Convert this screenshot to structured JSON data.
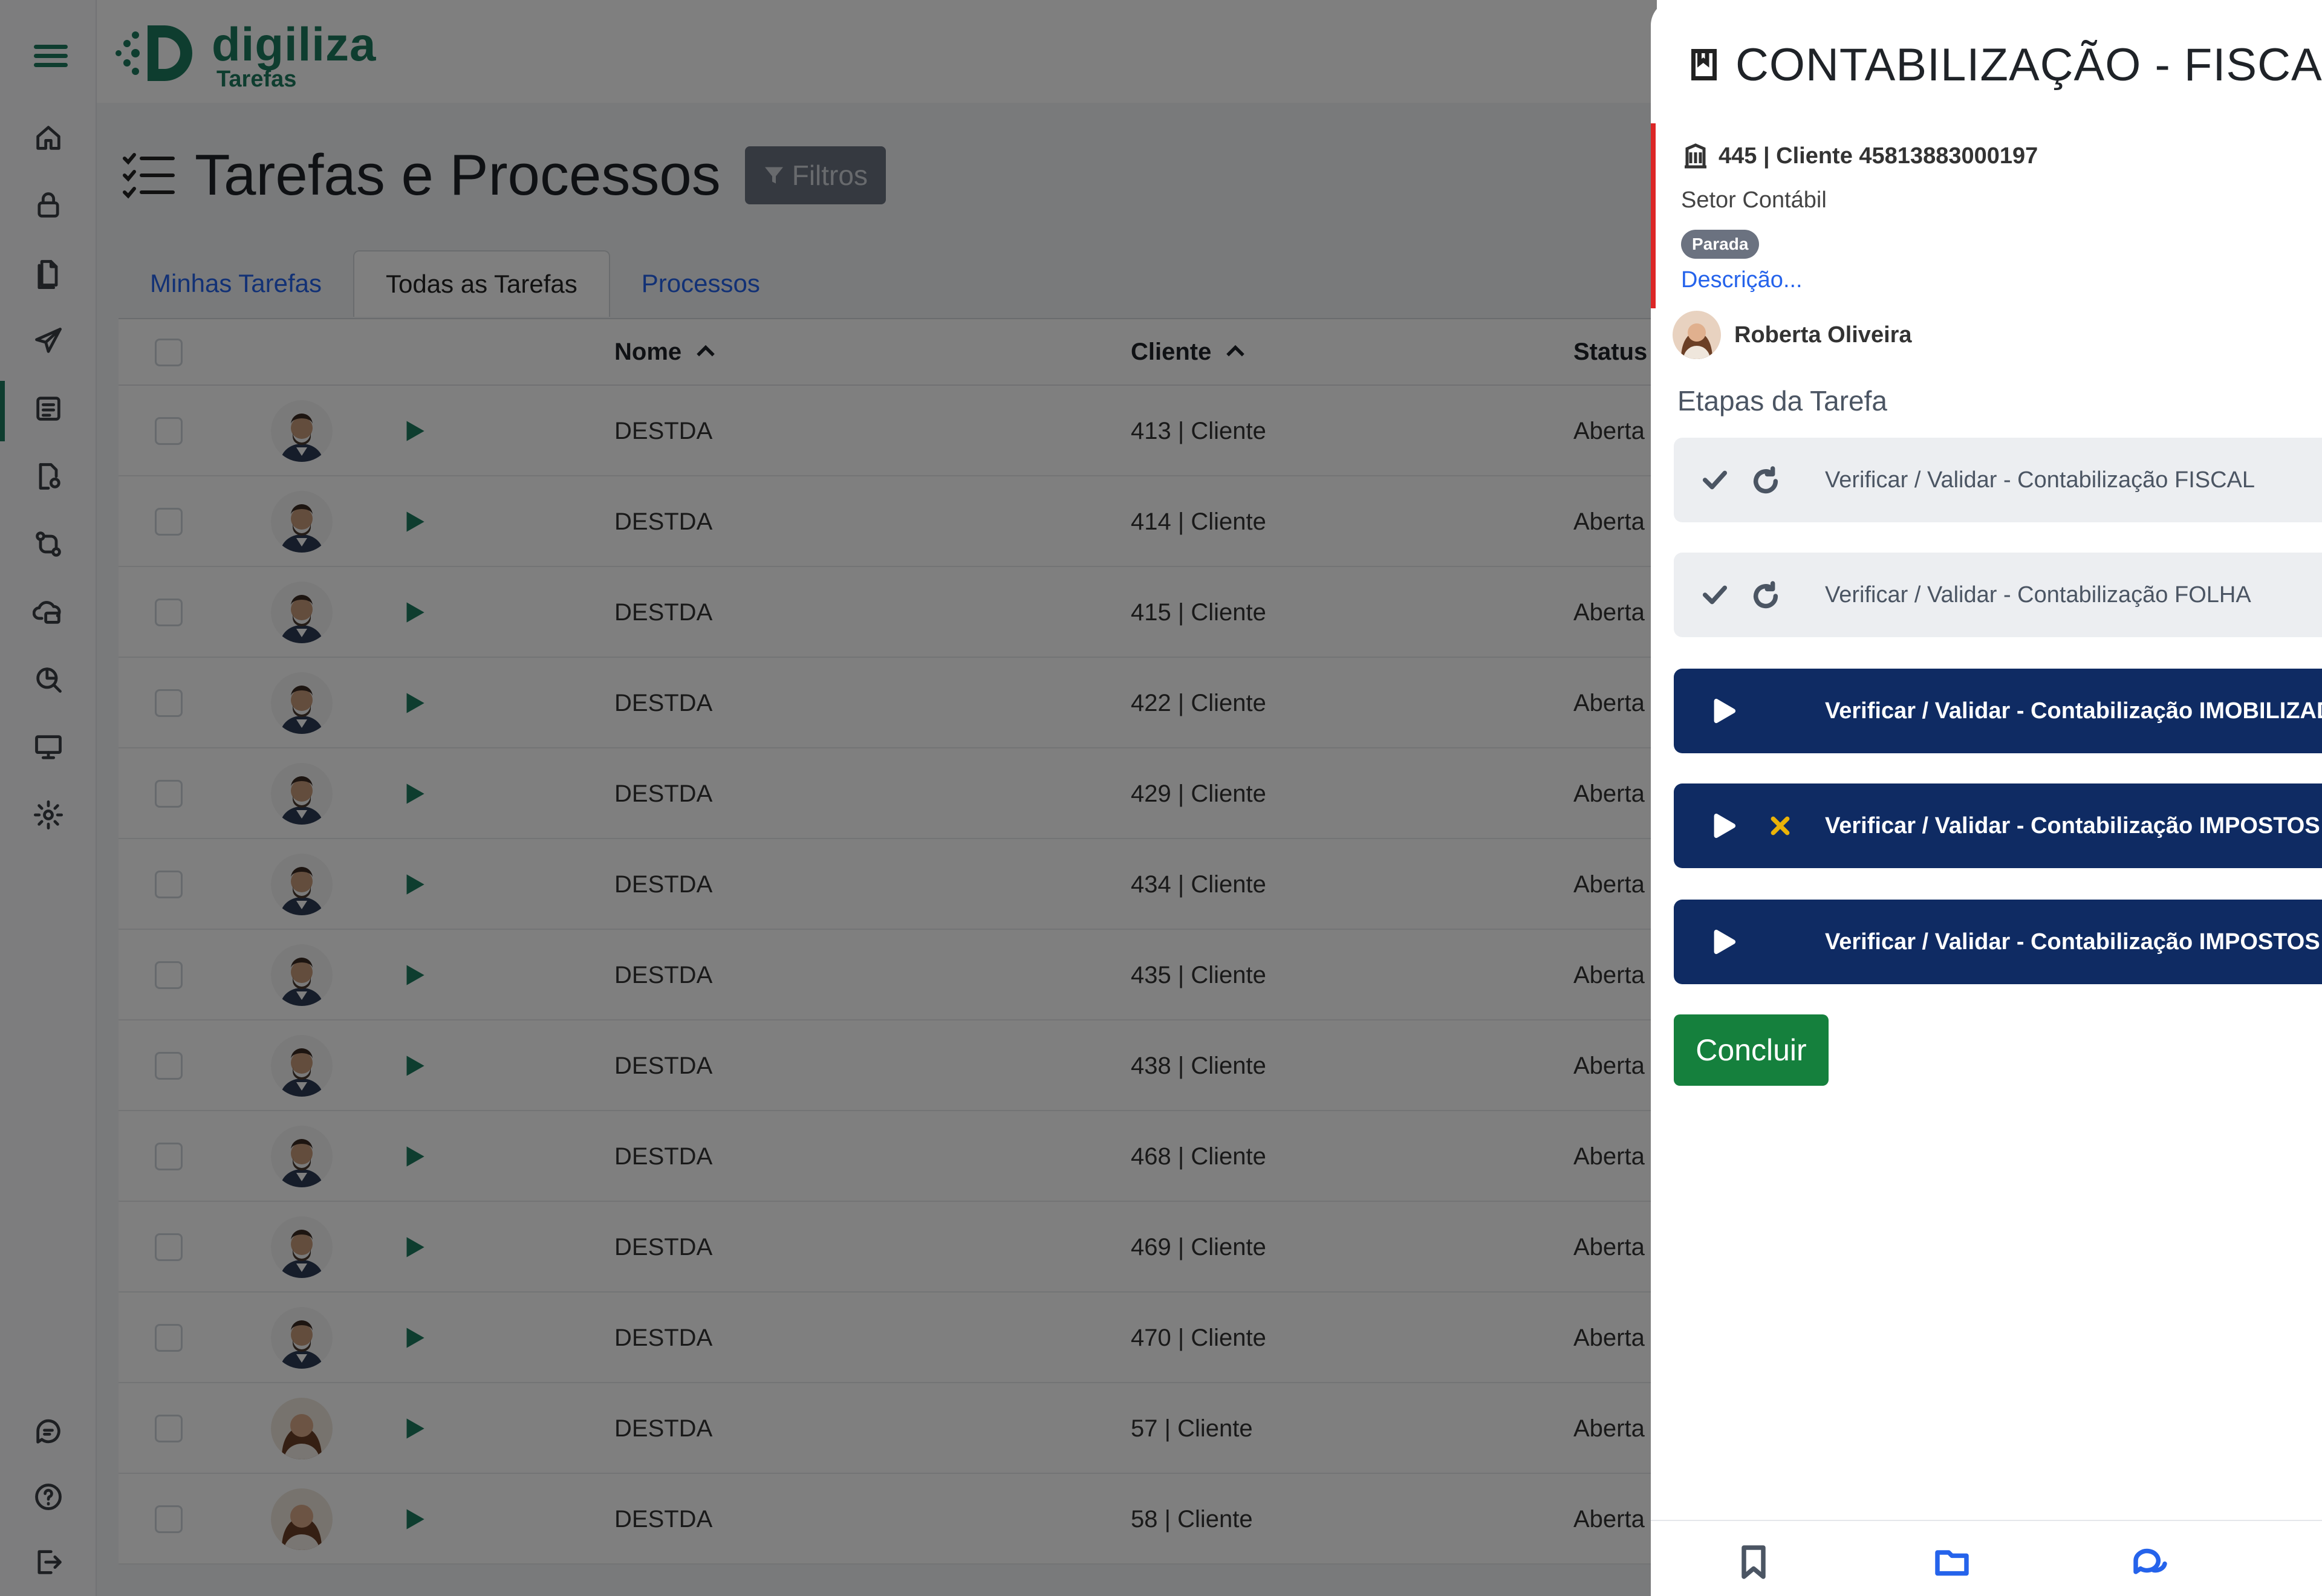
{
  "app": {
    "brand": "digiliza",
    "brand_sub": "Tarefas",
    "brand_color": "#1d7a5e"
  },
  "sidebar": {
    "icons": [
      "menu-icon",
      "home-icon",
      "lock-icon",
      "document-icon",
      "send-icon",
      "tasks-icon",
      "file-settings-icon",
      "flow-icon",
      "cloud-icon",
      "report-icon",
      "monitor-icon",
      "gear-icon",
      "chat-icon",
      "help-icon",
      "logout-icon"
    ]
  },
  "page": {
    "title": "Tarefas e Processos",
    "filter_label": "Filtros"
  },
  "tabs": [
    {
      "label": "Minhas Tarefas",
      "active": false
    },
    {
      "label": "Todas as Tarefas",
      "active": true
    },
    {
      "label": "Processos",
      "active": false
    }
  ],
  "table": {
    "columns": {
      "nome": "Nome",
      "cliente": "Cliente",
      "status": "Status"
    },
    "rows": [
      {
        "nome": "DESTDA",
        "cliente": "413 | Cliente",
        "status": "Aberta"
      },
      {
        "nome": "DESTDA",
        "cliente": "414 | Cliente",
        "status": "Aberta"
      },
      {
        "nome": "DESTDA",
        "cliente": "415 | Cliente",
        "status": "Aberta"
      },
      {
        "nome": "DESTDA",
        "cliente": "422 | Cliente",
        "status": "Aberta"
      },
      {
        "nome": "DESTDA",
        "cliente": "429 | Cliente",
        "status": "Aberta"
      },
      {
        "nome": "DESTDA",
        "cliente": "434 | Cliente",
        "status": "Aberta"
      },
      {
        "nome": "DESTDA",
        "cliente": "435 | Cliente",
        "status": "Aberta"
      },
      {
        "nome": "DESTDA",
        "cliente": "438 | Cliente",
        "status": "Aberta"
      },
      {
        "nome": "DESTDA",
        "cliente": "468 | Cliente",
        "status": "Aberta"
      },
      {
        "nome": "DESTDA",
        "cliente": "469 | Cliente",
        "status": "Aberta"
      },
      {
        "nome": "DESTDA",
        "cliente": "470 | Cliente",
        "status": "Aberta"
      },
      {
        "nome": "DESTDA",
        "cliente": "57 | Cliente",
        "status": "Aberta"
      },
      {
        "nome": "DESTDA",
        "cliente": "58 | Cliente",
        "status": "Aberta"
      }
    ]
  },
  "panel": {
    "title": "CONTABILIZAÇÃO - FISCAL, FO",
    "client": "445 | Cliente 45813883000197",
    "setor": "Setor Contábil",
    "badge": "Parada",
    "descricao": "Descrição...",
    "responsavel": "Roberta Oliveira",
    "etapas_title": "Etapas da Tarefa",
    "steps": [
      {
        "label": "Verificar / Validar - Contabilização FISCAL",
        "state": "done"
      },
      {
        "label": "Verificar / Validar - Contabilização FOLHA",
        "state": "done"
      },
      {
        "label": "Verificar / Validar - Contabilização IMOBILIZADO",
        "state": "todo"
      },
      {
        "label": "Verificar / Validar - Contabilização IMPOSTOS FI",
        "state": "todo"
      },
      {
        "label": "Verificar / Validar - Contabilização IMPOSTOS FO",
        "state": "todo"
      }
    ],
    "concluir_label": "Concluir",
    "footer_icons": [
      "bookmark-icon",
      "folder-icon",
      "comments-icon"
    ],
    "accent_color": "#2563eb"
  }
}
